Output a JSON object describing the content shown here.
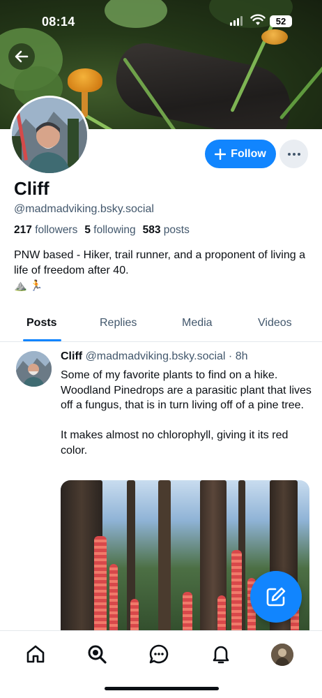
{
  "status_bar": {
    "time": "08:14",
    "battery": "52"
  },
  "profile": {
    "name": "Cliff",
    "handle": "@madmadviking.bsky.social",
    "followers_count": "217",
    "followers_label": "followers",
    "following_count": "5",
    "following_label": "following",
    "posts_count": "583",
    "posts_label": "posts",
    "bio": "PNW based - Hiker, trail runner, and a proponent of living a life of freedom after 40.",
    "bio_emoji": "⛰️ 🏃",
    "follow_label": "Follow"
  },
  "tabs": [
    {
      "label": "Posts",
      "active": true
    },
    {
      "label": "Replies",
      "active": false
    },
    {
      "label": "Media",
      "active": false
    },
    {
      "label": "Videos",
      "active": false
    }
  ],
  "post": {
    "author": "Cliff",
    "handle": "@madmadviking.bsky.social",
    "time": "· 8h",
    "paragraphs": [
      "Some of my favorite plants to find on a hike. Woodland Pinedrops are a parasitic plant that lives off a fungus, that is in turn living off of a pine tree.",
      "It makes almost no chlorophyll, giving it its red color."
    ]
  },
  "nav": {
    "items": [
      "home-icon",
      "search-icon",
      "chat-icon",
      "bell-icon",
      "profile-avatar"
    ]
  },
  "colors": {
    "accent": "#1185fe",
    "muted_text": "#42576c",
    "text": "#0b0f14"
  }
}
